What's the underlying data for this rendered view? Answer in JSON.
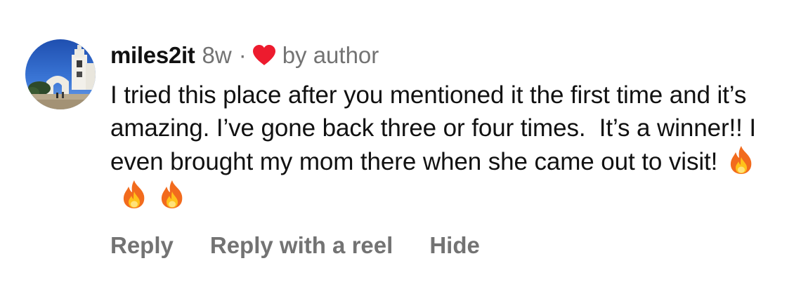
{
  "comment": {
    "username": "miles2it",
    "time_ago": "8w",
    "separator": "·",
    "liked_by_author_label": "by author",
    "text": "I tried this place after you mentioned it the first time and it’s amazing. I’ve gone back three or four times.  It’s a winner!! I even brought my mom there when she came out to visit!",
    "emoji_count": 3,
    "emoji_icon": "fire-emoji-icon",
    "heart_icon": "heart-icon",
    "heart_color": "#ED1B2E",
    "meta_color": "#737373",
    "avatar_icon": "avatar-photo-mission-church"
  },
  "actions": {
    "reply": "Reply",
    "reply_with_reel": "Reply with a reel",
    "hide": "Hide"
  }
}
